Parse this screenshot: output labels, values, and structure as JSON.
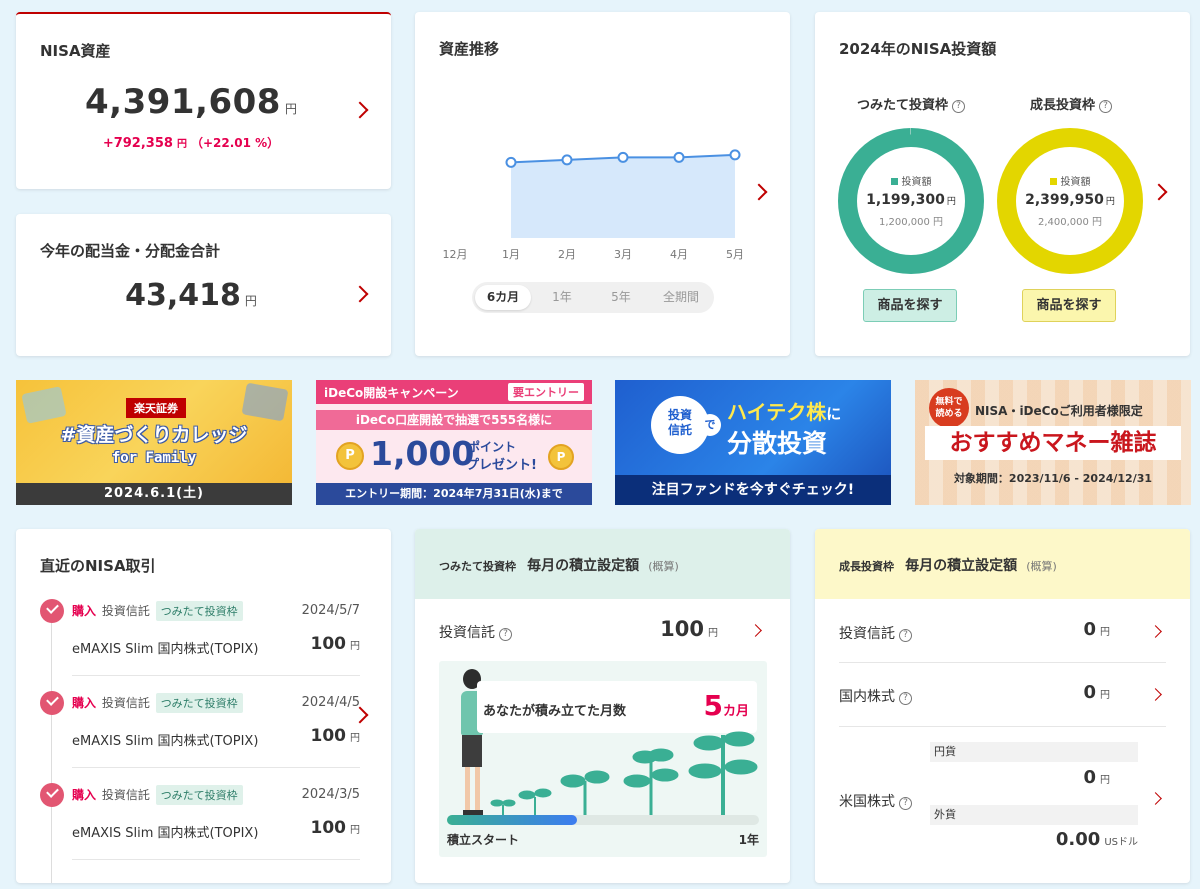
{
  "nisa_assets": {
    "title": "NISA資産",
    "amount": "4,391,608",
    "yen": "円",
    "gain": "+792,358",
    "gain_yen": "円",
    "gain_pct": "（+22.01 %）"
  },
  "dividends": {
    "title": "今年の配当金・分配金合計",
    "amount": "43,418",
    "yen": "円"
  },
  "asset_trend": {
    "title": "資産推移",
    "periods": [
      "6カ月",
      "1年",
      "5年",
      "全期間"
    ],
    "selected_period": "6カ月",
    "chart_data": {
      "type": "area",
      "categories": [
        "12月",
        "1月",
        "2月",
        "3月",
        "4月",
        "5月"
      ],
      "values": [
        null,
        0.6,
        0.62,
        0.64,
        0.64,
        0.66
      ],
      "title": "資産推移",
      "xlabel": "",
      "ylabel": "",
      "ylim": [
        0,
        1
      ]
    },
    "colors": {
      "line": "#4a90e2",
      "fill": "#d6e8fb"
    }
  },
  "nisa_investment": {
    "title": "2024年のNISA投資額",
    "tsumitate": {
      "label": "つみたて投資枠",
      "legend": "投資額",
      "amount": "1,199,300",
      "yen": "円",
      "limit": "1,200,000 円",
      "button": "商品を探す",
      "fill_fraction": 0.9994,
      "color": "#3aaf94"
    },
    "growth": {
      "label": "成長投資枠",
      "legend": "投資額",
      "amount": "2,399,950",
      "yen": "円",
      "limit": "2,400,000 円",
      "button": "商品を探す",
      "fill_fraction": 0.99998,
      "color": "#e3d600"
    }
  },
  "banners": [
    {
      "name": "rakuten-college-banner",
      "line1": "楽天証券",
      "line2": "#資産づくりカレッジ",
      "line3": "for Family",
      "line4": "2024.6.1(土)"
    },
    {
      "name": "ideco-campaign-banner",
      "line1": "iDeCo開設キャンペーン",
      "badge": "要エントリー",
      "line2": "iDeCo口座開設で抽選で555名様に",
      "line3": "1,000",
      "line3b": "ポイント",
      "line3c": "プレゼント!",
      "line4": "エントリー期間：2024年7月31日(水)まで"
    },
    {
      "name": "hitech-fund-banner",
      "circle1": "投資",
      "circle2": "信託",
      "circle3": "で",
      "line1": "ハイテク株",
      "line1b": "に",
      "line2": "分散投資",
      "line3": "注目ファンドを今すぐチェック!"
    },
    {
      "name": "money-magazine-banner",
      "badge1": "無料で",
      "badge2": "読める",
      "line1": "NISA・iDeCoご利用者様限定",
      "line2": "おすすめマネー雑誌",
      "line3": "対象期間：2023/11/6 - 2024/12/31"
    }
  ],
  "recent_trades": {
    "title": "直近のNISA取引",
    "items": [
      {
        "action": "購入",
        "type": "投資信託",
        "tag": "つみたて投資枠",
        "date": "2024/5/7",
        "fund": "eMAXIS Slim 国内株式(TOPIX)",
        "amount": "100",
        "yen": "円"
      },
      {
        "action": "購入",
        "type": "投資信託",
        "tag": "つみたて投資枠",
        "date": "2024/4/5",
        "fund": "eMAXIS Slim 国内株式(TOPIX)",
        "amount": "100",
        "yen": "円"
      },
      {
        "action": "購入",
        "type": "投資信託",
        "tag": "つみたて投資枠",
        "date": "2024/3/5",
        "fund": "eMAXIS Slim 国内株式(TOPIX)",
        "amount": "100",
        "yen": "円"
      }
    ]
  },
  "tsumitate_monthly": {
    "small_label": "つみたて投資枠",
    "title": "毎月の積立設定額",
    "note": "(概算)",
    "row_label": "投資信託",
    "amount": "100",
    "yen": "円",
    "months_label": "あなたが積み立てた月数",
    "months_value": "5",
    "months_unit": "カ月",
    "progress_start": "積立スタート",
    "progress_end": "1年",
    "progress_fraction": 0.4167
  },
  "growth_monthly": {
    "small_label": "成長投資枠",
    "title": "毎月の積立設定額",
    "note": "(概算)",
    "rows": [
      {
        "label": "投資信託",
        "amount": "0",
        "yen": "円"
      },
      {
        "label": "国内株式",
        "amount": "0",
        "yen": "円"
      }
    ],
    "us": {
      "label": "米国株式",
      "jpy_label": "円貨",
      "jpy_amount": "0",
      "jpy_yen": "円",
      "fx_label": "外貨",
      "fx_amount": "0.00",
      "fx_unit": "USドル"
    }
  }
}
